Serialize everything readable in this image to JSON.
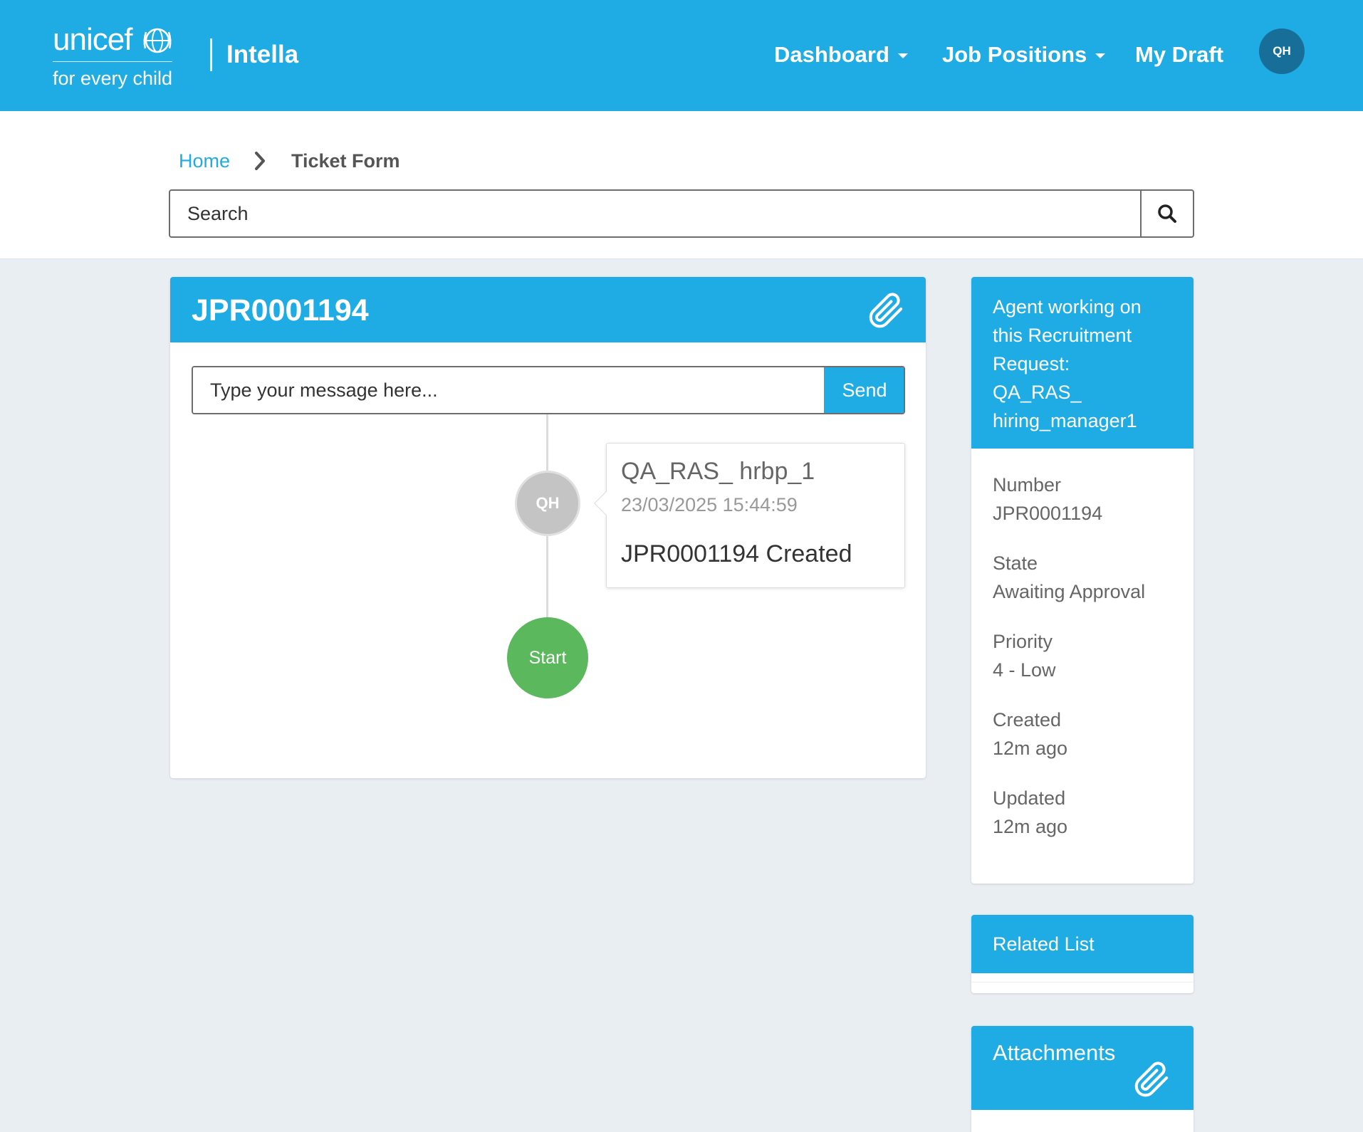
{
  "header": {
    "logo_word": "unicef",
    "logo_tagline": "for every child",
    "app_name": "Intella",
    "nav": [
      {
        "label": "Dashboard",
        "has_caret": true
      },
      {
        "label": "Job Positions",
        "has_caret": true
      },
      {
        "label": "My Draft",
        "has_caret": false
      }
    ],
    "user_initials": "QH"
  },
  "breadcrumb": {
    "home": "Home",
    "current": "Ticket Form"
  },
  "search": {
    "placeholder": "Search"
  },
  "ticket": {
    "number": "JPR0001194",
    "message_placeholder": "Type your message here...",
    "send_label": "Send",
    "activity": [
      {
        "initials": "QH",
        "user": "QA_RAS_ hrbp_1",
        "timestamp": "23/03/2025 15:44:59",
        "message": "JPR0001194 Created"
      }
    ],
    "start_label": "Start"
  },
  "sidebar": {
    "agent_lines": [
      "Agent working on",
      "this Recruitment",
      "Request:",
      "QA_RAS_",
      "hiring_manager1"
    ],
    "fields": [
      {
        "label": "Number",
        "value": "JPR0001194"
      },
      {
        "label": "State",
        "value": "Awaiting Approval"
      },
      {
        "label": "Priority",
        "value": "4 - Low"
      },
      {
        "label": "Created",
        "value": "12m ago"
      },
      {
        "label": "Updated",
        "value": "12m ago"
      }
    ],
    "related_title": "Related List",
    "attachments_title": "Attachments"
  },
  "colors": {
    "primary": "#1fabe3",
    "background": "#e9eef3",
    "start_node": "#5cb85c",
    "avatar_dark": "#176f99"
  }
}
